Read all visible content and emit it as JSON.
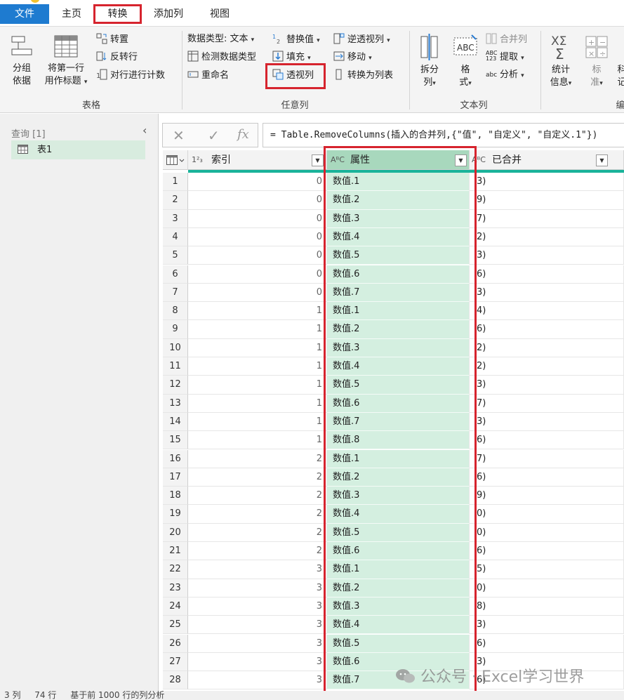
{
  "menu": {
    "tabs": [
      {
        "label": "文件"
      },
      {
        "label": "主页"
      },
      {
        "label": "转换"
      },
      {
        "label": "添加列"
      },
      {
        "label": "视图"
      }
    ]
  },
  "ribbon": {
    "table_group": {
      "label": "表格",
      "group_by": [
        "分组",
        "依据"
      ],
      "use_first_row": [
        "将第一行",
        "用作标题"
      ],
      "transpose": "转置",
      "reverse_rows": "反转行",
      "count_rows": "对行进行计数"
    },
    "any_column_group": {
      "label": "任意列",
      "data_type": "数据类型: 文本",
      "detect_type": "检测数据类型",
      "rename": "重命名",
      "replace_values": "替换值",
      "fill": "填充",
      "pivot_column": "透视列",
      "unpivot_columns": "逆透视列",
      "move": "移动",
      "convert_to_list": "转换为列表"
    },
    "text_column_group": {
      "label": "文本列",
      "split_column": [
        "拆分",
        "列"
      ],
      "format": [
        "格",
        "式"
      ],
      "merge_columns": "合并列",
      "extract": "提取",
      "parse": "分析",
      "extract_icon_text": "ABC 123",
      "parse_icon_text": "abc"
    },
    "number_column_group": {
      "label": "编",
      "statistics": [
        "统计",
        "信息"
      ],
      "standard": [
        "标",
        "准"
      ],
      "scientific": [
        "科",
        "记"
      ]
    }
  },
  "queries": {
    "title": "查询 [1]",
    "items": [
      {
        "label": "表1"
      }
    ]
  },
  "formula": {
    "text": "= Table.RemoveColumns(插入的合并列,{\"值\", \"自定义\", \"自定义.1\"})"
  },
  "grid": {
    "columns": [
      {
        "type": "1²₃",
        "name": "索引"
      },
      {
        "type": "AᴮC",
        "name": "属性"
      },
      {
        "type": "AᴮC",
        "name": "已合并"
      }
    ],
    "rows": [
      {
        "n": "1",
        "idx": "0",
        "attr": "数值.1",
        "merged": "3)"
      },
      {
        "n": "2",
        "idx": "0",
        "attr": "数值.2",
        "merged": "9)"
      },
      {
        "n": "3",
        "idx": "0",
        "attr": "数值.3",
        "merged": "7)"
      },
      {
        "n": "4",
        "idx": "0",
        "attr": "数值.4",
        "merged": "2)"
      },
      {
        "n": "5",
        "idx": "0",
        "attr": "数值.5",
        "merged": "3)"
      },
      {
        "n": "6",
        "idx": "0",
        "attr": "数值.6",
        "merged": "6)"
      },
      {
        "n": "7",
        "idx": "0",
        "attr": "数值.7",
        "merged": "3)"
      },
      {
        "n": "8",
        "idx": "1",
        "attr": "数值.1",
        "merged": "4)"
      },
      {
        "n": "9",
        "idx": "1",
        "attr": "数值.2",
        "merged": "6)"
      },
      {
        "n": "10",
        "idx": "1",
        "attr": "数值.3",
        "merged": "2)"
      },
      {
        "n": "11",
        "idx": "1",
        "attr": "数值.4",
        "merged": "2)"
      },
      {
        "n": "12",
        "idx": "1",
        "attr": "数值.5",
        "merged": "3)"
      },
      {
        "n": "13",
        "idx": "1",
        "attr": "数值.6",
        "merged": "7)"
      },
      {
        "n": "14",
        "idx": "1",
        "attr": "数值.7",
        "merged": "3)"
      },
      {
        "n": "15",
        "idx": "1",
        "attr": "数值.8",
        "merged": "6)"
      },
      {
        "n": "16",
        "idx": "2",
        "attr": "数值.1",
        "merged": "7)"
      },
      {
        "n": "17",
        "idx": "2",
        "attr": "数值.2",
        "merged": "6)"
      },
      {
        "n": "18",
        "idx": "2",
        "attr": "数值.3",
        "merged": "9)"
      },
      {
        "n": "19",
        "idx": "2",
        "attr": "数值.4",
        "merged": "0)"
      },
      {
        "n": "20",
        "idx": "2",
        "attr": "数值.5",
        "merged": "0)"
      },
      {
        "n": "21",
        "idx": "2",
        "attr": "数值.6",
        "merged": "6)"
      },
      {
        "n": "22",
        "idx": "3",
        "attr": "数值.1",
        "merged": "5)"
      },
      {
        "n": "23",
        "idx": "3",
        "attr": "数值.2",
        "merged": "0)"
      },
      {
        "n": "24",
        "idx": "3",
        "attr": "数值.3",
        "merged": "8)"
      },
      {
        "n": "25",
        "idx": "3",
        "attr": "数值.4",
        "merged": "3)"
      },
      {
        "n": "26",
        "idx": "3",
        "attr": "数值.5",
        "merged": "6)"
      },
      {
        "n": "27",
        "idx": "3",
        "attr": "数值.6",
        "merged": "3)"
      },
      {
        "n": "28",
        "idx": "3",
        "attr": "数值.7",
        "merged": "6)"
      }
    ]
  },
  "status": {
    "columns": "3 列",
    "rows": "74 行",
    "profiling": "基于前 1000 行的列分析"
  },
  "watermark": "公众号 · Excel学习世界",
  "colors": {
    "file_tab": "#1e7bd0",
    "highlight_red": "#d6242e",
    "selected_column": "#d4efe0",
    "selected_header": "#a8d8bd",
    "quality_bar": "#19b39a"
  }
}
